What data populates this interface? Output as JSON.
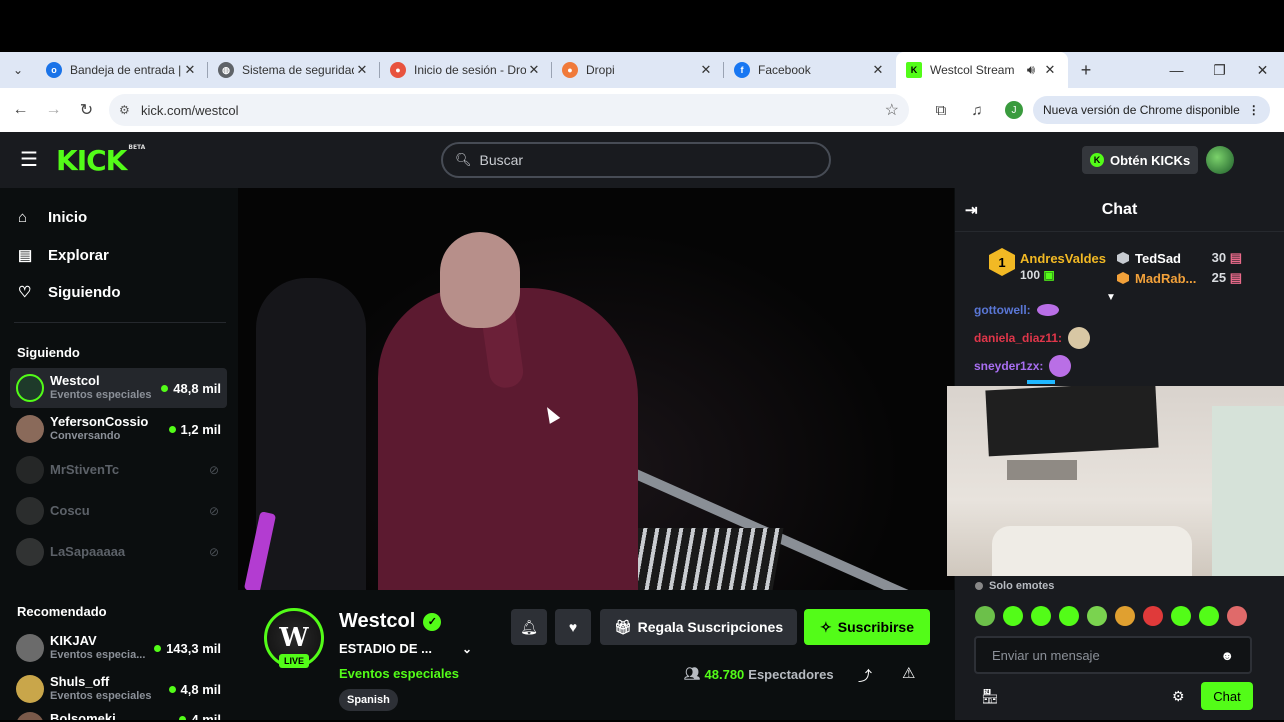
{
  "browser": {
    "tabs": [
      {
        "title": "Bandeja de entrada |",
        "favicon_color": "#1a73e8",
        "favicon": "outlook-icon",
        "active": false
      },
      {
        "title": "Sistema de seguridad",
        "favicon_color": "#5f6368",
        "favicon": "globe-icon",
        "active": false
      },
      {
        "title": "Inicio de sesión - Dro",
        "favicon_color": "#e8533e",
        "favicon": "dropi-login-icon",
        "active": false
      },
      {
        "title": "Dropi",
        "favicon_color": "#f07a3a",
        "favicon": "dropi-icon",
        "active": false
      },
      {
        "title": "Facebook",
        "favicon_color": "#1877f2",
        "favicon": "facebook-icon",
        "active": false
      },
      {
        "title": "Westcol Stream",
        "favicon_color": "#53fc18",
        "favicon": "kick-icon",
        "active": true
      }
    ],
    "url": "kick.com/westcol",
    "profile_initial": "J",
    "update_label": "Nueva versión de Chrome disponible"
  },
  "kick": {
    "logo": "KICK",
    "logo_badge": "BETA",
    "search_placeholder": "Buscar",
    "kicks_button": "Obtén KICKs",
    "nav": [
      {
        "label": "Inicio",
        "icon": "home-icon"
      },
      {
        "label": "Explorar",
        "icon": "browse-icon"
      },
      {
        "label": "Siguiendo",
        "icon": "heart-icon"
      }
    ],
    "following_title": "Siguiendo",
    "following": [
      {
        "name": "Westcol",
        "category": "Eventos especiales",
        "viewers": "48,8 mil",
        "live": true,
        "avatar_color": "#1e3a2a"
      },
      {
        "name": "YefersonCossio",
        "category": "Conversando",
        "viewers": "1,2 mil",
        "live": true,
        "avatar_color": "#8a6a5a"
      },
      {
        "name": "MrStivenTc",
        "category": "",
        "viewers": "",
        "live": false,
        "avatar_color": "#555"
      },
      {
        "name": "Coscu",
        "category": "",
        "viewers": "",
        "live": false,
        "avatar_color": "#666"
      },
      {
        "name": "LaSapaaaaa",
        "category": "",
        "viewers": "",
        "live": false,
        "avatar_color": "#777"
      }
    ],
    "recommended_title": "Recomendado",
    "recommended": [
      {
        "name": "KIKJAV",
        "category": "Eventos especia...",
        "viewers": "143,3 mil",
        "avatar_color": "#6b6b6b"
      },
      {
        "name": "Shuls_off",
        "category": "Eventos especiales",
        "viewers": "4,8 mil",
        "avatar_color": "#c9a64a"
      },
      {
        "name": "Bolsomeki",
        "category": "",
        "viewers": "4 mil",
        "avatar_color": "#7a5a4a"
      }
    ],
    "streamer": {
      "name": "Westcol",
      "avatar_letter": "W",
      "live_label": "LIVE",
      "title": "ESTADIO DE ...",
      "category": "Eventos especiales",
      "language": "Spanish",
      "gift_label": "Regala Suscripciones",
      "subscribe_label": "Suscribirse",
      "viewers_count": "48.780",
      "viewers_label": "Espectadores"
    },
    "chat": {
      "title": "Chat",
      "leaderboard": {
        "top": {
          "name": "AndresValdes",
          "amount": "100",
          "rank": "1"
        },
        "others": [
          {
            "name": "TedSad",
            "amount": "30",
            "color": "#d9dce0"
          },
          {
            "name": "MadRab...",
            "amount": "25",
            "color": "#f2a13a"
          }
        ]
      },
      "messages": [
        {
          "user": "gottowell:",
          "color": "#5a77d6",
          "emote_color": "#b96fe6"
        },
        {
          "user": "daniela_diaz11:",
          "color": "#e0364a",
          "emote_color": "#d8c7a4"
        },
        {
          "user": "sneyder1zx:",
          "color": "#a86ef0",
          "emote_color": "#b96fe6"
        }
      ],
      "emotes_only": "Solo emotes",
      "input_placeholder": "Enviar un mensaje",
      "send_label": "Chat"
    },
    "accent_color": "#53fc18"
  }
}
